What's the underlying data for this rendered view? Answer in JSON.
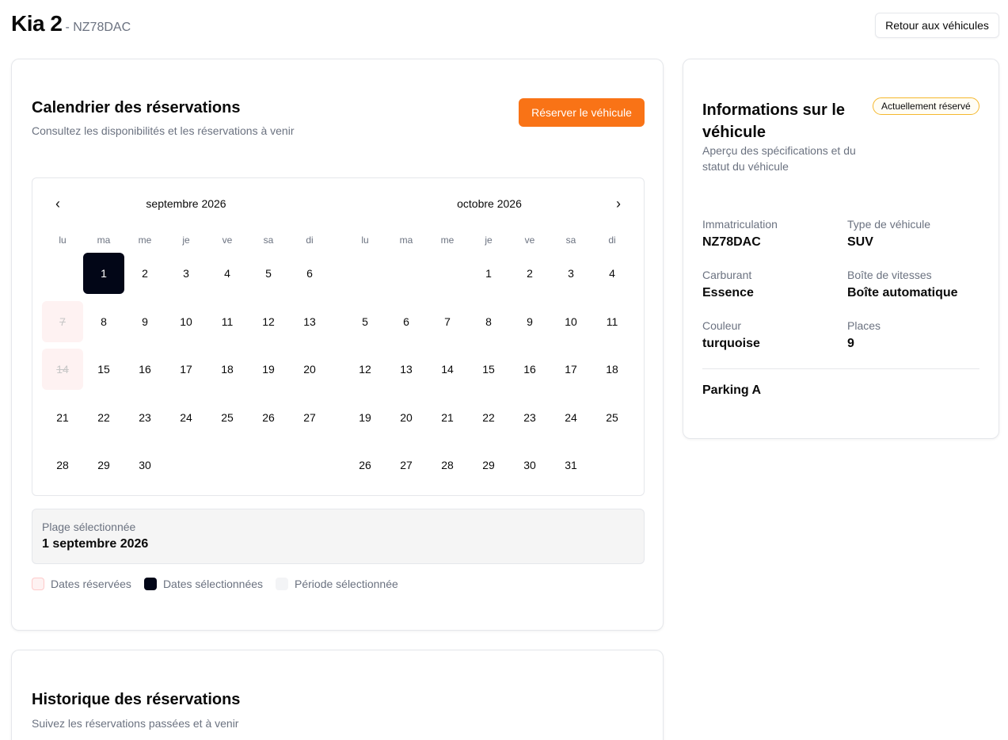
{
  "header": {
    "title": "Kia 2",
    "plate": "- NZ78DAC",
    "back_label": "Retour aux véhicules"
  },
  "calendar_card": {
    "title": "Calendrier des réservations",
    "description": "Consultez les disponibilités et les réservations à venir",
    "reserve_label": "Réserver le véhicule",
    "prev_icon": "‹",
    "next_icon": "›",
    "weekdays": [
      "lu",
      "ma",
      "me",
      "je",
      "ve",
      "sa",
      "di"
    ],
    "months": [
      {
        "title": "septembre 2026",
        "weeks": [
          [
            "",
            "1",
            "2",
            "3",
            "4",
            "5",
            "6"
          ],
          [
            "7",
            "8",
            "9",
            "10",
            "11",
            "12",
            "13"
          ],
          [
            "14",
            "15",
            "16",
            "17",
            "18",
            "19",
            "20"
          ],
          [
            "21",
            "22",
            "23",
            "24",
            "25",
            "26",
            "27"
          ],
          [
            "28",
            "29",
            "30",
            "",
            "",
            "",
            ""
          ]
        ],
        "reserved": [
          "7",
          "14"
        ],
        "selected": [
          "1"
        ]
      },
      {
        "title": "octobre 2026",
        "weeks": [
          [
            "",
            "",
            "",
            "1",
            "2",
            "3",
            "4"
          ],
          [
            "5",
            "6",
            "7",
            "8",
            "9",
            "10",
            "11"
          ],
          [
            "12",
            "13",
            "14",
            "15",
            "16",
            "17",
            "18"
          ],
          [
            "19",
            "20",
            "21",
            "22",
            "23",
            "24",
            "25"
          ],
          [
            "26",
            "27",
            "28",
            "29",
            "30",
            "31",
            ""
          ]
        ],
        "reserved": [],
        "selected": []
      }
    ],
    "range_label": "Plage sélectionnée",
    "range_value": "1 septembre 2026",
    "legend": [
      {
        "label": "Dates réservées",
        "color": "#fef2f2"
      },
      {
        "label": "Dates sélectionnées",
        "color": "#020617"
      },
      {
        "label": "Période sélectionnée",
        "color": "#f3f4f6"
      }
    ]
  },
  "info_card": {
    "title_line1": "Informations sur le",
    "title_line2": "véhicule",
    "desc_line1": "Aperçu des spécifications et du",
    "desc_line2": "statut du véhicule",
    "badge": "Actuellement réservé",
    "specs": [
      {
        "label": "Immatriculation",
        "value": "NZ78DAC"
      },
      {
        "label": "Type de véhicule",
        "value": "SUV"
      },
      {
        "label": "Carburant",
        "value": "Essence"
      },
      {
        "label": "Boîte de vitesses",
        "value": "Boîte automatique"
      },
      {
        "label": "Couleur",
        "value": "turquoise"
      },
      {
        "label": "Places",
        "value": "9"
      }
    ],
    "location": "Parking A"
  },
  "history_card": {
    "title": "Historique des réservations",
    "description": "Suivez les réservations passées et à venir"
  },
  "colors": {
    "accent": "#f97316",
    "selected": "#020617",
    "reserved": "#fef2f2",
    "badge_border": "#f5b82e"
  }
}
